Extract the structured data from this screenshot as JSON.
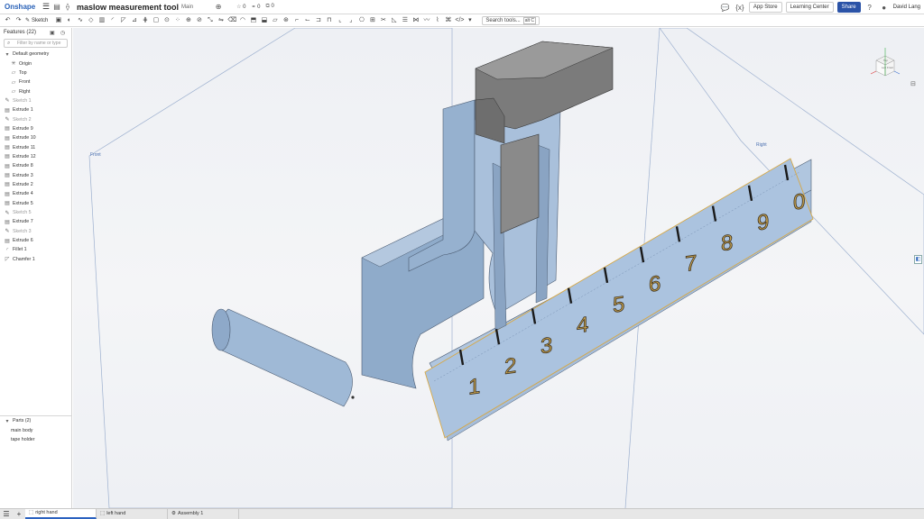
{
  "app": {
    "logo": "Onshape",
    "title": "maslow measurement tool",
    "branch": "Main",
    "counts": {
      "likes": "0",
      "links": "0",
      "copies": "0"
    },
    "buttons": {
      "app_store": "App Store",
      "learning_center": "Learning Center",
      "share": "Share"
    },
    "user": "David Lang"
  },
  "toolbar": {
    "sketch_label": "Sketch",
    "search_label": "Search tools...",
    "search_shortcut": "alt C"
  },
  "features": {
    "header": "Features (22)",
    "filter_placeholder": "Filter by name or type",
    "items": [
      {
        "label": "Default geometry",
        "icon": "chevron-down-icon"
      },
      {
        "label": "Origin",
        "icon": "origin-icon"
      },
      {
        "label": "Top",
        "icon": "plane-icon"
      },
      {
        "label": "Front",
        "icon": "plane-icon"
      },
      {
        "label": "Right",
        "icon": "plane-icon"
      },
      {
        "label": "Sketch 1",
        "icon": "sketch-icon"
      },
      {
        "label": "Extrude 1",
        "icon": "extrude-icon"
      },
      {
        "label": "Sketch 2",
        "icon": "sketch-icon"
      },
      {
        "label": "Extrude 9",
        "icon": "extrude-icon"
      },
      {
        "label": "Extrude 10",
        "icon": "extrude-icon"
      },
      {
        "label": "Extrude 11",
        "icon": "extrude-icon"
      },
      {
        "label": "Extrude 12",
        "icon": "extrude-icon"
      },
      {
        "label": "Extrude 8",
        "icon": "extrude-icon"
      },
      {
        "label": "Extrude 3",
        "icon": "extrude-icon"
      },
      {
        "label": "Extrude 2",
        "icon": "extrude-icon"
      },
      {
        "label": "Extrude 4",
        "icon": "extrude-icon"
      },
      {
        "label": "Extrude 5",
        "icon": "extrude-icon"
      },
      {
        "label": "Sketch 5",
        "icon": "sketch-icon"
      },
      {
        "label": "Extrude 7",
        "icon": "extrude-icon"
      },
      {
        "label": "Sketch 3",
        "icon": "sketch-icon"
      },
      {
        "label": "Extrude 6",
        "icon": "extrude-icon"
      },
      {
        "label": "Fillet 1",
        "icon": "fillet-icon"
      },
      {
        "label": "Chamfer 1",
        "icon": "chamfer-icon"
      }
    ]
  },
  "parts": {
    "header": "Parts (2)",
    "items": [
      "main body",
      "tape holder"
    ]
  },
  "viewport": {
    "plane_front": "Front",
    "plane_right": "Right",
    "scale_numbers": [
      "1",
      "2",
      "3",
      "4",
      "5",
      "6",
      "7",
      "8",
      "9",
      "0"
    ],
    "view_cube": {
      "top": "Top",
      "left": "Left",
      "front": "Front"
    }
  },
  "tabs": [
    {
      "label": "right hand",
      "active": true
    },
    {
      "label": "left hand",
      "active": false
    },
    {
      "label": "Assembly 1",
      "active": false
    }
  ],
  "colors": {
    "accent": "#2b53a7",
    "part_blue": "#9bb6d4",
    "part_blue_dark": "#6f8fb5",
    "tape_holder_grey": "#8a8a8a",
    "edge_gold": "#e0b64a"
  }
}
